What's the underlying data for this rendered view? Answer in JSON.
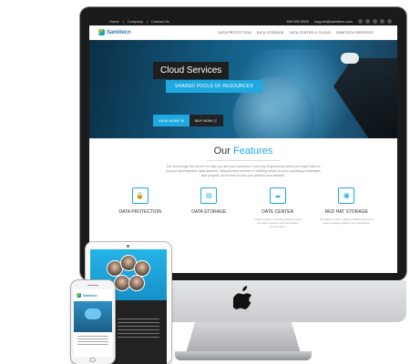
{
  "topbar": {
    "links": [
      "Home",
      "Company",
      "Contact Us"
    ],
    "phone": "555 555 5555",
    "email": "support@samitecn.com"
  },
  "navbar": {
    "brand": "Samitecn",
    "menu": [
      "DATA PROTECTION",
      "DATA STORAGE",
      "DATA CENTER & CLOUD",
      "SAMITECN SERVICES"
    ]
  },
  "hero": {
    "title": "Cloud Services",
    "subtitle": "SHARED POOLS OF RESOURCES",
    "view_more": "VIEW MORE",
    "buy_now": "BUY NOW"
  },
  "features": {
    "heading_plain": "Our ",
    "heading_highlight": "Features",
    "description": "Our technology firm is here to help you and your business. From any engineering needs you might have to product development, data systems, infrastructure services or staffing needs for your upcoming challenges and projects, we're here to help you achieve your dreams.",
    "cards": [
      {
        "title": "DATA PROTECTION",
        "icon": "lock-icon"
      },
      {
        "title": "DATA STORAGE",
        "icon": "database-icon"
      },
      {
        "title": "DATE CENTER",
        "icon": "cloud-icon",
        "desc": "A data center is a facility used to house computer systems and associated components."
      },
      {
        "title": "RED HAT STORAGE",
        "icon": "server-icon",
        "desc": "Provides a robust, highly scalable block and object storage platform for enterprises."
      }
    ]
  },
  "phone": {
    "brand": "Samitecn"
  },
  "colors": {
    "accent": "#1ea9e1",
    "dark": "#1e1e1e"
  }
}
